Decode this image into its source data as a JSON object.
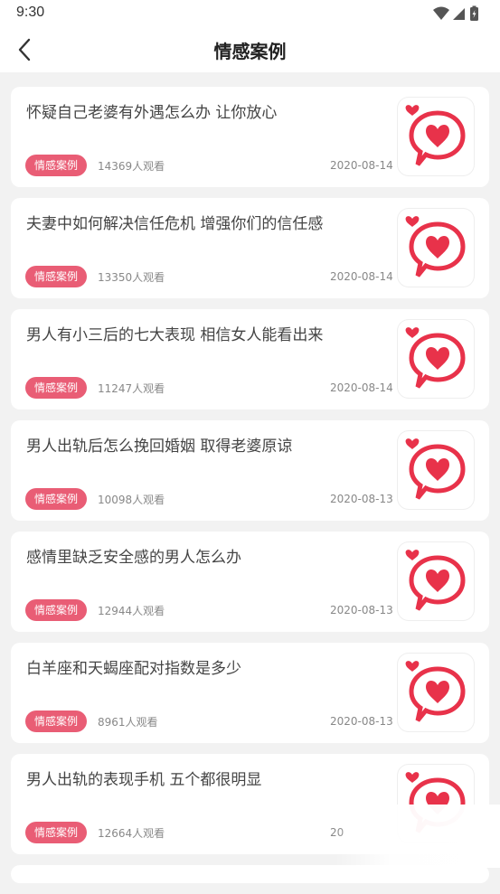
{
  "status_bar": {
    "time": "9:30"
  },
  "header": {
    "title": "情感案例"
  },
  "articles": [
    {
      "title": "怀疑自己老婆有外遇怎么办 让你放心",
      "tag": "情感案例",
      "views": "14369人观看",
      "date": "2020-08-14"
    },
    {
      "title": "夫妻中如何解决信任危机 增强你们的信任感",
      "tag": "情感案例",
      "views": "13350人观看",
      "date": "2020-08-14"
    },
    {
      "title": "男人有小三后的七大表现 相信女人能看出来",
      "tag": "情感案例",
      "views": "11247人观看",
      "date": "2020-08-14"
    },
    {
      "title": "男人出轨后怎么挽回婚姻 取得老婆原谅",
      "tag": "情感案例",
      "views": "10098人观看",
      "date": "2020-08-13"
    },
    {
      "title": "感情里缺乏安全感的男人怎么办",
      "tag": "情感案例",
      "views": "12944人观看",
      "date": "2020-08-13"
    },
    {
      "title": "白羊座和天蝎座配对指数是多少",
      "tag": "情感案例",
      "views": "8961人观看",
      "date": "2020-08-13"
    },
    {
      "title": "男人出轨的表现手机 五个都很明显",
      "tag": "情感案例",
      "views": "12664人观看",
      "date": "20"
    }
  ],
  "icons": {
    "back": "back-arrow-icon",
    "thumbnail": "heart-speech-bubble-icon"
  },
  "colors": {
    "tag_bg": "#e95d75",
    "heart": "#e8324a"
  }
}
